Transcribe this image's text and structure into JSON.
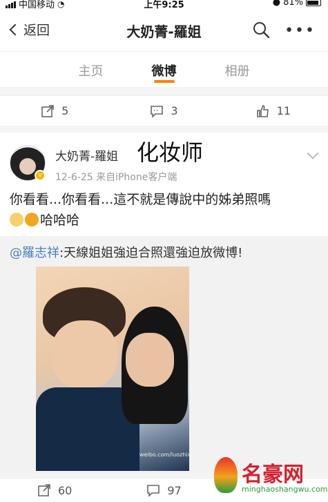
{
  "status_bar": {
    "carrier": "中国移动",
    "time": "上午9:25",
    "battery": "81%"
  },
  "nav": {
    "back_label": "返回",
    "title": "大奶菁-羅姐"
  },
  "tabs": [
    {
      "label": "主页",
      "active": false
    },
    {
      "label": "微博",
      "active": true
    },
    {
      "label": "相册",
      "active": false
    }
  ],
  "prev_post_actions": {
    "reposts": "5",
    "comments": "3",
    "likes": "11"
  },
  "post": {
    "author": "大奶菁-羅姐",
    "handwritten_label": "化妆师",
    "meta": "12-6-25 来自iPhone客户端",
    "text": "你看看...你看看...這不就是傳說中的姊弟照嗎",
    "text_tail": "哈哈哈",
    "repost_mention": "@羅志祥",
    "repost_text": ":天線姐姐強迫合照還強迫放微博!",
    "photo_watermark": "weibo.com/luozhixiang"
  },
  "next_actions": {
    "reposts": "60",
    "comments": "97"
  },
  "brand": {
    "name": "名豪网",
    "url": "minghaoshangwu.com"
  },
  "colors": {
    "accent": "#ff8200",
    "mention": "#4a7fbf",
    "badge": "#f7b500"
  }
}
